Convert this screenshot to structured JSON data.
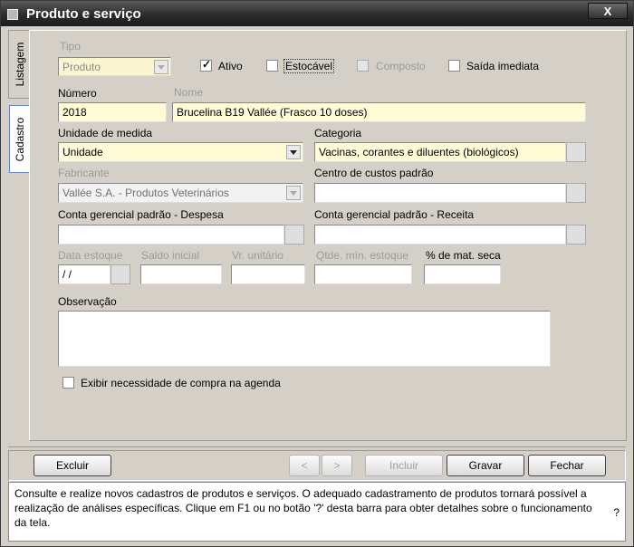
{
  "window": {
    "title": "Produto e serviço",
    "close_label": "X"
  },
  "tabs": {
    "listagem": "Listagem",
    "cadastro": "Cadastro"
  },
  "form": {
    "tipo_label": "Tipo",
    "tipo_value": "Produto",
    "ativo_label": "Ativo",
    "ativo_checked": true,
    "estocavel_label": "Estocável",
    "composto_label": "Composto",
    "saida_label": "Saída imediata",
    "numero_label": "Número",
    "numero_value": "2018",
    "nome_label": "Nome",
    "nome_value": "Brucelina B19 Vallée (Frasco 10 doses)",
    "unidade_label": "Unidade de medida",
    "unidade_value": "Unidade",
    "categoria_label": "Categoria",
    "categoria_value": "Vacinas, corantes e diluentes (biológicos)",
    "fabricante_label": "Fabricante",
    "fabricante_value": "Vallée S.A. - Produtos Veterinários",
    "centro_label": "Centro de custos padrão",
    "centro_value": "",
    "conta_despesa_label": "Conta gerencial padrão - Despesa",
    "conta_despesa_value": "",
    "conta_receita_label": "Conta gerencial padrão - Receita",
    "conta_receita_value": "",
    "data_estoque_label": "Data estoque",
    "data_estoque_value": " / /",
    "saldo_label": "Saldo inicial",
    "vr_label": "Vr. unitário",
    "qtde_label": "Qtde. mín. estoque",
    "mat_seca_label": "% de mat. seca",
    "obs_label": "Observação",
    "exibir_label": "Exibir necessidade de compra na agenda"
  },
  "buttons": {
    "excluir": "Excluir",
    "prev": "<",
    "next": ">",
    "incluir": "Incluir",
    "gravar": "Gravar",
    "fechar": "Fechar"
  },
  "help": {
    "text": "Consulte e realize novos cadastros de produtos e serviços. O adequado cadastramento de produtos tornará possível a realização de análises específicas. Clique em F1 ou no botão '?' desta barra para obter detalhes sobre o funcionamento da tela.",
    "question": "?"
  }
}
